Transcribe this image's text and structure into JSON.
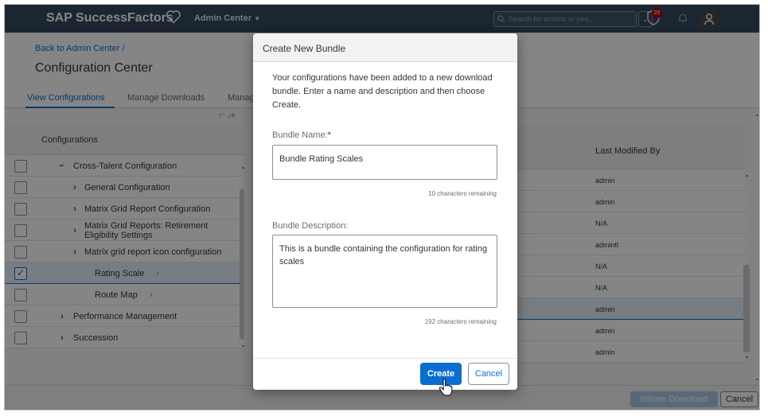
{
  "shell": {
    "brand": "SAP SuccessFactors",
    "admin_menu": "Admin Center",
    "search_placeholder": "Search for actions or peo...",
    "notification_count": "20"
  },
  "page": {
    "breadcrumb": "Back to Admin Center /",
    "title": "Configuration Center",
    "tabs": [
      {
        "label": "View Configurations",
        "active": true
      },
      {
        "label": "Manage Downloads",
        "active": false
      },
      {
        "label": "Manag",
        "active": false
      }
    ]
  },
  "tree": {
    "header": "Configurations",
    "rows": [
      {
        "label": "Cross-Talent Configuration",
        "expanded": true,
        "checked": false
      },
      {
        "label": "General Configuration",
        "checked": false
      },
      {
        "label": "Matrix Grid Report Configuration",
        "checked": false
      },
      {
        "label": "Matrix Grid Reports: Retirement Eligibility Settings",
        "checked": false
      },
      {
        "label": "Matrix grid report icon configuration",
        "checked": false
      },
      {
        "label": "Rating Scale",
        "checked": true,
        "selected": true
      },
      {
        "label": "Route Map",
        "checked": false
      },
      {
        "label": "Performance Management",
        "checked": false
      },
      {
        "label": "Succession",
        "checked": false
      }
    ]
  },
  "right_table": {
    "header": "Last Modified By",
    "values": [
      "admin",
      "admin",
      "N/A",
      "admintl",
      "N/A",
      "N/A",
      "admin",
      "admin",
      "admin"
    ]
  },
  "footer": {
    "initiate_label": "Initiate Download",
    "cancel_label": "Cancel"
  },
  "dialog": {
    "title": "Create New Bundle",
    "intro": "Your configurations have been added to a new download bundle. Enter a name and description and then choose Create.",
    "name_label": "Bundle Name:",
    "name_required": "*",
    "name_value": "Bundle Rating Scales",
    "name_remaining": "10 characters remaining",
    "desc_label": "Bundle Description:",
    "desc_value": "This is a bundle containing the configuration for rating scales",
    "desc_remaining": "192 characters remaining",
    "create_label": "Create",
    "cancel_label": "Cancel"
  },
  "colors": {
    "shell": "#354a5f",
    "accent": "#0a6ed1",
    "required": "#bb0000"
  }
}
